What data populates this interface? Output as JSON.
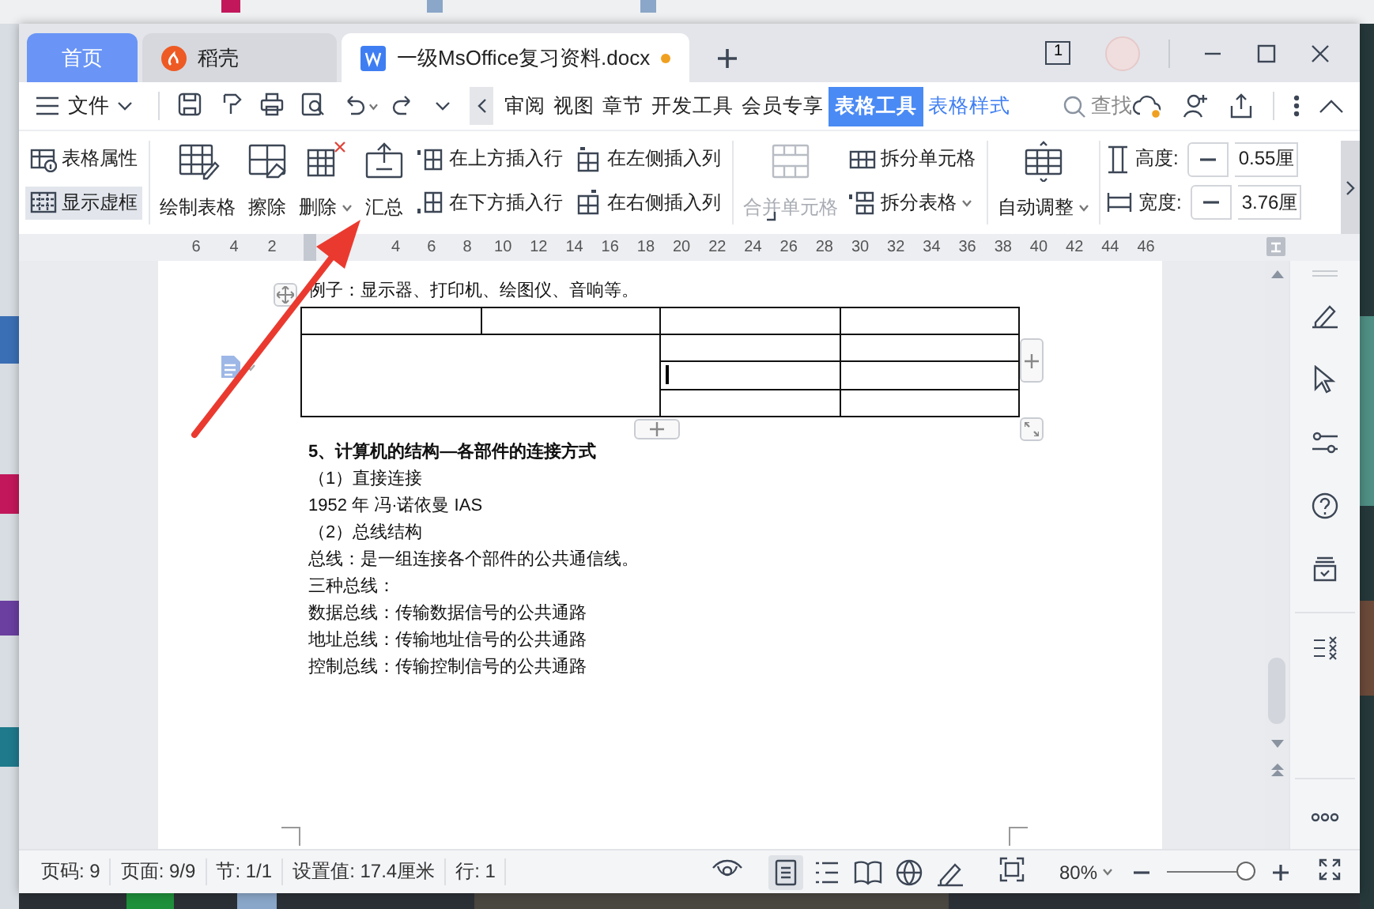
{
  "tabs": [
    {
      "label": "首页",
      "kind": "home",
      "selected": false
    },
    {
      "label": "稻壳",
      "kind": "store",
      "selected": false
    },
    {
      "label": "一级MsOffice复习资料.docx",
      "kind": "document",
      "selected": true,
      "unsaved": true
    }
  ],
  "window_count": "1",
  "menubar": {
    "file_menu": "文件",
    "ribbon_tabs": [
      {
        "label": "审阅",
        "kind": "normal",
        "selected": false
      },
      {
        "label": "视图",
        "kind": "normal",
        "selected": false
      },
      {
        "label": "章节",
        "kind": "normal",
        "selected": false
      },
      {
        "label": "开发工具",
        "kind": "normal",
        "selected": false
      },
      {
        "label": "会员专享",
        "kind": "normal",
        "selected": false
      },
      {
        "label": "表格工具",
        "kind": "normal",
        "selected": true
      },
      {
        "label": "表格样式",
        "kind": "context",
        "selected": false
      }
    ],
    "search_label": "查找"
  },
  "ribbon": {
    "groups": [
      {
        "columns": [
          {
            "kind": "stack",
            "buttons": [
              {
                "label": "表格属性",
                "pressed": false
              },
              {
                "label": "显示虚框",
                "pressed": true
              }
            ]
          }
        ]
      },
      {
        "columns": [
          {
            "kind": "large",
            "label": "绘制表格",
            "disabled": false,
            "dropdown": false
          },
          {
            "kind": "large",
            "label": "擦除",
            "disabled": false,
            "dropdown": false
          },
          {
            "kind": "large",
            "label": "删除",
            "disabled": false,
            "dropdown": true
          },
          {
            "kind": "large",
            "label": "汇总",
            "disabled": false,
            "dropdown": false
          },
          {
            "kind": "stack",
            "buttons": [
              {
                "label": "在上方插入行",
                "pressed": false
              },
              {
                "label": "在下方插入行",
                "pressed": false
              }
            ]
          },
          {
            "kind": "stack",
            "buttons": [
              {
                "label": "在左侧插入列",
                "pressed": false
              },
              {
                "label": "在右侧插入列",
                "pressed": false
              }
            ]
          }
        ]
      },
      {
        "columns": [
          {
            "kind": "large",
            "label": "合并单元格",
            "disabled": true,
            "dropdown": false
          },
          {
            "kind": "stack",
            "buttons": [
              {
                "label": "拆分单元格",
                "pressed": false,
                "dropdown": false
              },
              {
                "label": "拆分表格",
                "pressed": false,
                "dropdown": true
              }
            ]
          }
        ]
      },
      {
        "columns": [
          {
            "kind": "large",
            "label": "自动调整",
            "disabled": false,
            "dropdown": true
          }
        ]
      },
      {
        "columns": [
          {
            "kind": "fields",
            "fields": [
              {
                "label": "高度:",
                "value": "0.55厘"
              },
              {
                "label": "宽度:",
                "value": "3.76厘"
              }
            ]
          }
        ]
      }
    ]
  },
  "ruler": {
    "left_numbers": [
      "6",
      "4",
      "2"
    ],
    "right_numbers": [
      "4",
      "6",
      "8",
      "10",
      "12",
      "14",
      "16",
      "18",
      "20",
      "22",
      "24",
      "26",
      "28",
      "30",
      "32",
      "34",
      "36",
      "38",
      "40",
      "42",
      "44",
      "46"
    ]
  },
  "document": {
    "intro": "例子：显示器、打印机、绘图仪、音响等。",
    "table": {
      "rows": [
        {
          "cells": [
            {
              "merged": false,
              "cursor": false
            },
            {
              "merged": false,
              "cursor": false
            },
            {
              "merged": false,
              "cursor": false
            },
            {
              "merged": false,
              "cursor": false
            }
          ]
        },
        {
          "cells": [
            {
              "merged": true,
              "cursor": false
            },
            {
              "merged": false,
              "cursor": false
            },
            {
              "merged": false,
              "cursor": false
            }
          ]
        },
        {
          "cells": [
            {
              "merged": false,
              "cursor": true
            },
            {
              "merged": false,
              "cursor": false
            }
          ]
        },
        {
          "cells": [
            {
              "merged": false,
              "cursor": false
            },
            {
              "merged": false,
              "cursor": false
            }
          ]
        }
      ]
    },
    "paragraphs": [
      {
        "kind": "heading",
        "text": "5、计算机的结构—各部件的连接方式"
      },
      {
        "kind": "body",
        "text": "（1）直接连接"
      },
      {
        "kind": "body",
        "text": "1952 年  冯·诺依曼  IAS"
      },
      {
        "kind": "body",
        "text": "（2）总线结构"
      },
      {
        "kind": "body",
        "text": "总线：是一组连接各个部件的公共通信线。"
      },
      {
        "kind": "body",
        "text": "三种总线："
      },
      {
        "kind": "body",
        "text": "数据总线：传输数据信号的公共通路"
      },
      {
        "kind": "body",
        "text": "地址总线：传输地址信号的公共通路"
      },
      {
        "kind": "body",
        "text": "控制总线：传输控制信号的公共通路"
      }
    ]
  },
  "status_bar": {
    "fields": [
      "页码: 9",
      "页面: 9/9",
      "节: 1/1",
      "设置值: 17.4厘米",
      "行: 1"
    ],
    "views": [
      {
        "selected": true
      },
      {
        "selected": false
      },
      {
        "selected": false
      },
      {
        "selected": false
      },
      {
        "selected": false
      }
    ],
    "zoom": "80%",
    "zoom_slider": {
      "level": 0.9
    }
  }
}
